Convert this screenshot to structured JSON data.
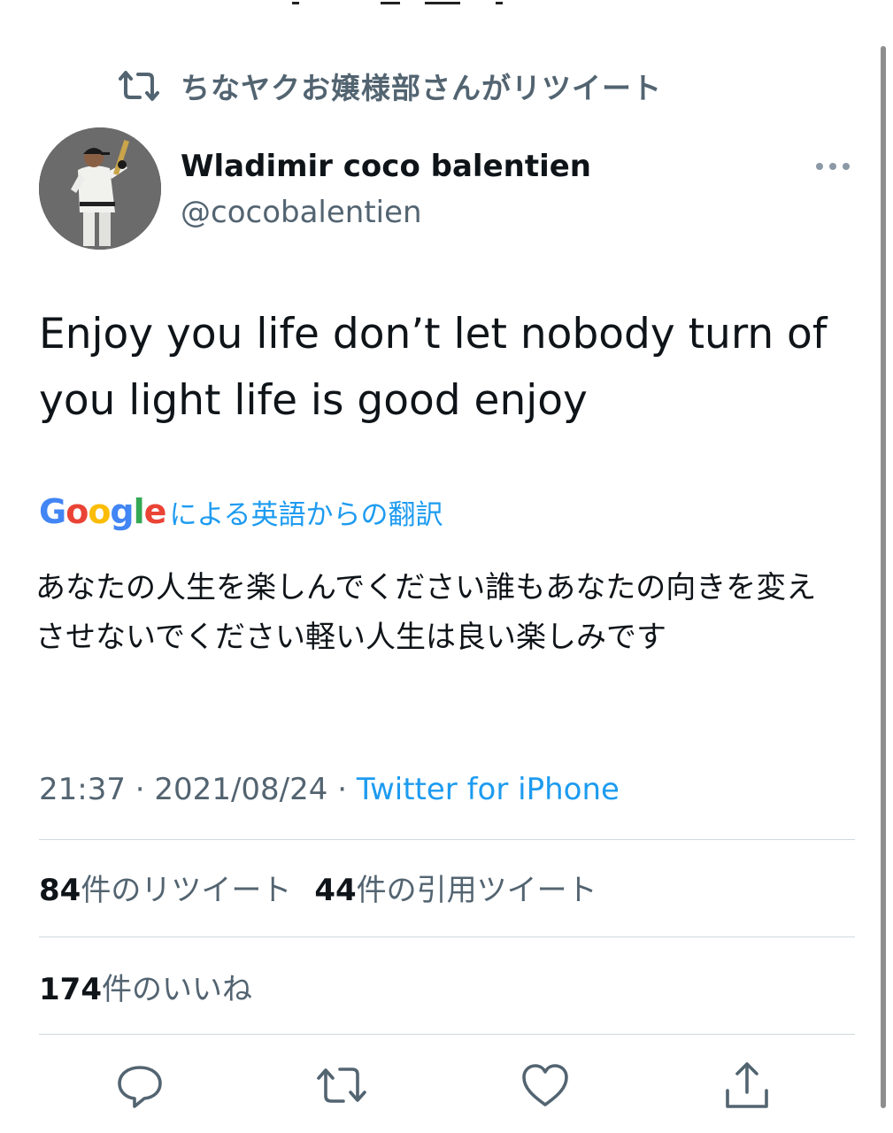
{
  "retweet_banner": {
    "text": "ちなヤクお嬢様部さんがリツイート",
    "icon": "retweet-icon"
  },
  "author": {
    "display_name": "Wladimir coco balentien",
    "handle": "@cocobalentien",
    "avatar": "avatar-photo"
  },
  "tweet": {
    "text": "Enjoy you life don’t let nobody turn of you light life is good enjoy"
  },
  "translation": {
    "provider_logo": "Google",
    "label": "による英語からの翻訳",
    "text": "あなたの人生を楽しんでください誰もあなたの向きを変えさせないでください軽い人生は良い楽しみです"
  },
  "meta": {
    "time": "21:37",
    "separator": " · ",
    "date": "2021/08/24",
    "source": "Twitter for iPhone"
  },
  "stats": {
    "retweets_count": "84",
    "retweets_label": "件のリツイート",
    "quotes_count": "44",
    "quotes_label": "件の引用ツイート",
    "likes_count": "174",
    "likes_label": "件のいいね"
  },
  "actions": [
    "reply-icon",
    "retweet-icon",
    "like-icon",
    "share-icon"
  ],
  "colors": {
    "accent": "#1d9bf0",
    "secondary_text": "#536471",
    "primary_text": "#0f1419",
    "divider": "#cfd9de"
  }
}
